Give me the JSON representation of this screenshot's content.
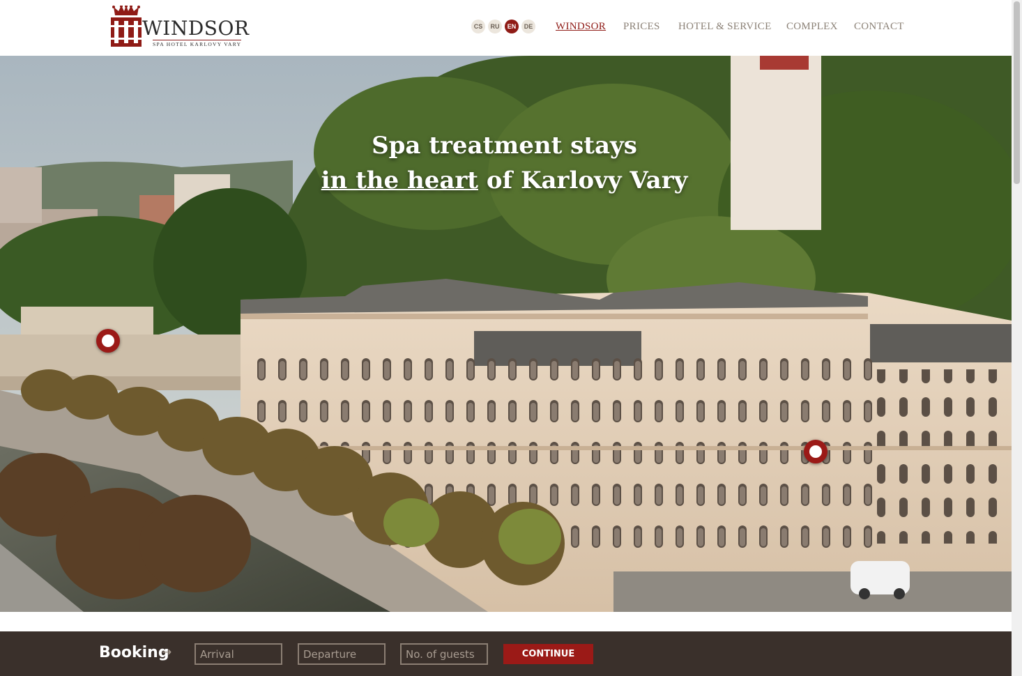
{
  "header": {
    "logo": {
      "name": "WINDSOR",
      "tagline": "SPA HOTEL KARLOVY VARY"
    },
    "languages": [
      "CS",
      "RU",
      "EN",
      "DE"
    ],
    "active_language": "EN",
    "nav": [
      {
        "label": "WINDSOR",
        "active": true
      },
      {
        "label": "PRICES",
        "active": false
      },
      {
        "label": "HOTEL & SERVICE",
        "active": false
      },
      {
        "label": "COMPLEX",
        "active": false
      },
      {
        "label": "CONTACT",
        "active": false
      }
    ]
  },
  "hero": {
    "headline_line1": "Spa treatment stays",
    "headline_line2_underlined": "in the heart",
    "headline_line2_rest": " of Karlovy Vary"
  },
  "booking": {
    "title": "Booking",
    "arrow": "→",
    "arrival_placeholder": "Arrival",
    "departure_placeholder": "Departure",
    "guests_placeholder": "No. of guests",
    "continue_label": "CONTINUE"
  },
  "colors": {
    "brand_red": "#8f1b16",
    "booking_bg": "#3a302b",
    "nav_text": "#8b8176"
  }
}
